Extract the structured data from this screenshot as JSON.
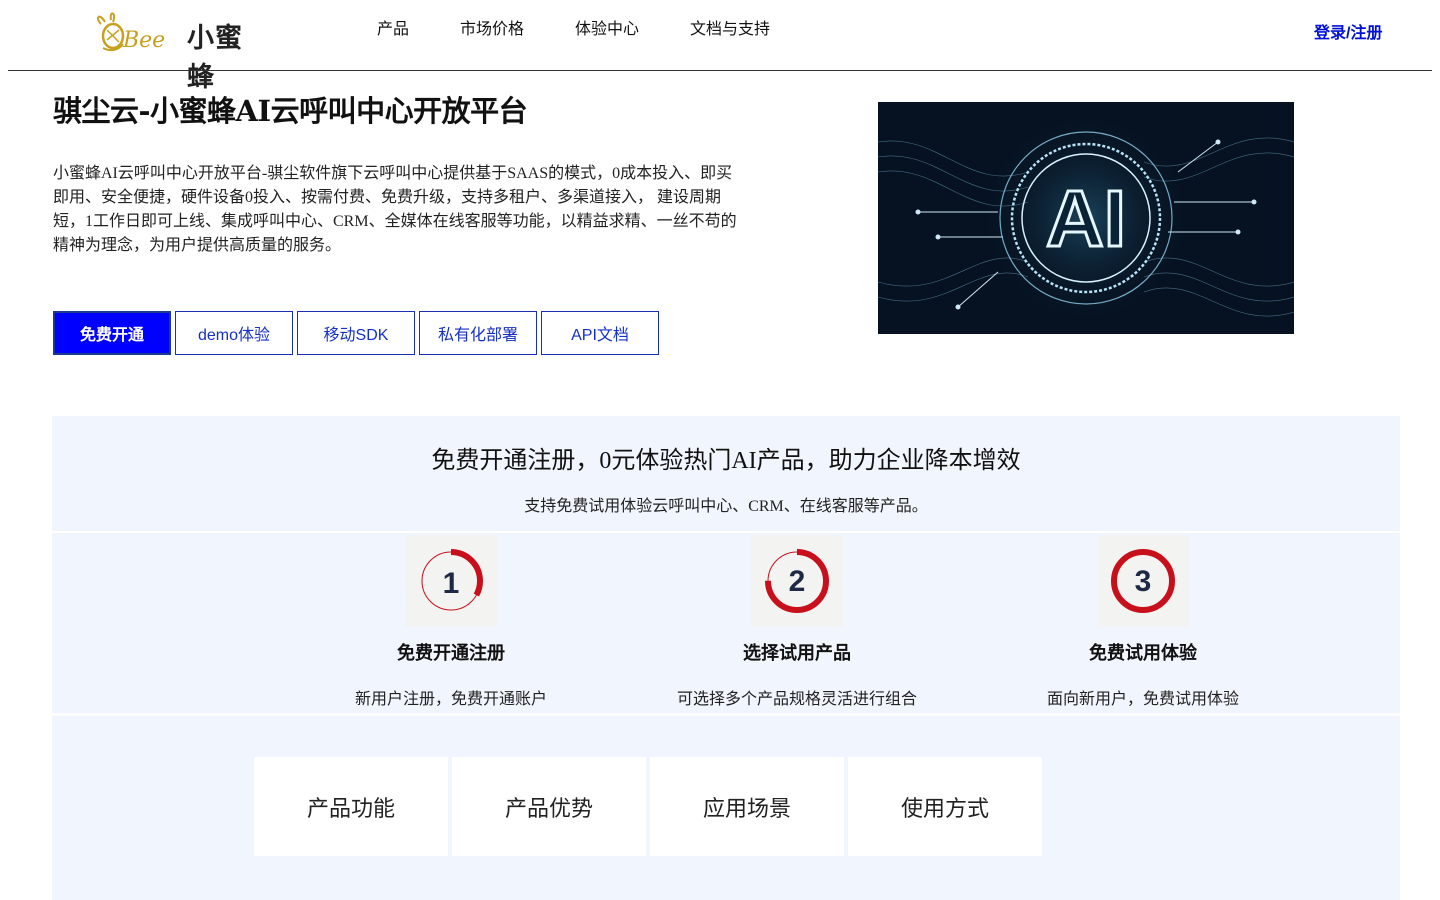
{
  "header": {
    "logo_text": "小蜜蜂",
    "logo_script": "Bee",
    "nav": [
      "产品",
      "市场价格",
      "体验中心",
      "文档与支持"
    ],
    "login": "登录/注册"
  },
  "hero": {
    "title": "骐尘云-小蜜蜂AI云呼叫中心开放平台",
    "description": "小蜜蜂AI云呼叫中心开放平台-骐尘软件旗下云呼叫中心提供基于SAAS的模式，0成本投入、即买即用、安全便捷，硬件设备0投入、按需付费、免费升级，支持多租户、多渠道接入， 建设周期短，1工作日即可上线、集成呼叫中心、CRM、全媒体在线客服等功能，以精益求精、一丝不苟的精神为理念，为用户提供高质量的服务。",
    "buttons": [
      "免费开通",
      "demo体验",
      "移动SDK",
      "私有化部署",
      "API文档"
    ],
    "image_text": "AI"
  },
  "promo": {
    "title": "免费开通注册，0元体验热门AI产品，助力企业降本增效",
    "subtitle": "支持免费试用体验云呼叫中心、CRM、在线客服等产品。"
  },
  "steps": [
    {
      "number": "1",
      "title": "免费开通注册",
      "desc": "新用户注册，免费开通账户",
      "progress": 0.33
    },
    {
      "number": "2",
      "title": "选择试用产品",
      "desc": "可选择多个产品规格灵活进行组合",
      "progress": 0.75
    },
    {
      "number": "3",
      "title": "免费试用体验",
      "desc": "面向新用户，免费试用体验",
      "progress": 1.0
    }
  ],
  "tabs": [
    "产品功能",
    "产品优势",
    "应用场景",
    "使用方式"
  ],
  "colors": {
    "accent": "#0000ff",
    "link": "#0010d8",
    "ring": "#c8101c",
    "section_bg": "#f1f5fd"
  }
}
